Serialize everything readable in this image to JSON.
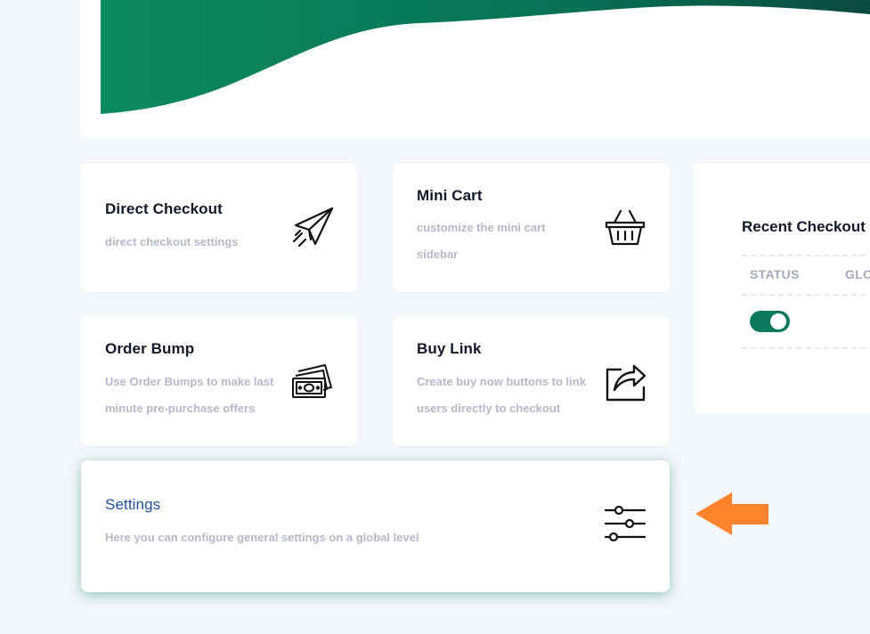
{
  "colors": {
    "brand_green": "#0b7a5c",
    "arrow_orange": "#ff832b",
    "settings_title": "#1f4fa3",
    "muted_text": "#b4b8c8"
  },
  "cards": {
    "direct_checkout": {
      "title": "Direct Checkout",
      "desc": "direct checkout settings",
      "icon": "paper-plane-icon"
    },
    "mini_cart": {
      "title": "Mini Cart",
      "desc": "customize the mini cart sidebar",
      "icon": "basket-icon"
    },
    "order_bump": {
      "title": "Order Bump",
      "desc": "Use Order Bumps to make last minute pre-purchase offers",
      "icon": "money-icon"
    },
    "buy_link": {
      "title": "Buy Link",
      "desc": "Create buy now buttons to link users directly to checkout",
      "icon": "share-icon"
    },
    "settings": {
      "title": "Settings",
      "desc": "Here you can configure general settings on a global level",
      "icon": "sliders-icon"
    }
  },
  "recent_checkout": {
    "title": "Recent Checkout",
    "columns": [
      "STATUS",
      "GLO"
    ],
    "rows": [
      {
        "status_enabled": true
      }
    ]
  }
}
